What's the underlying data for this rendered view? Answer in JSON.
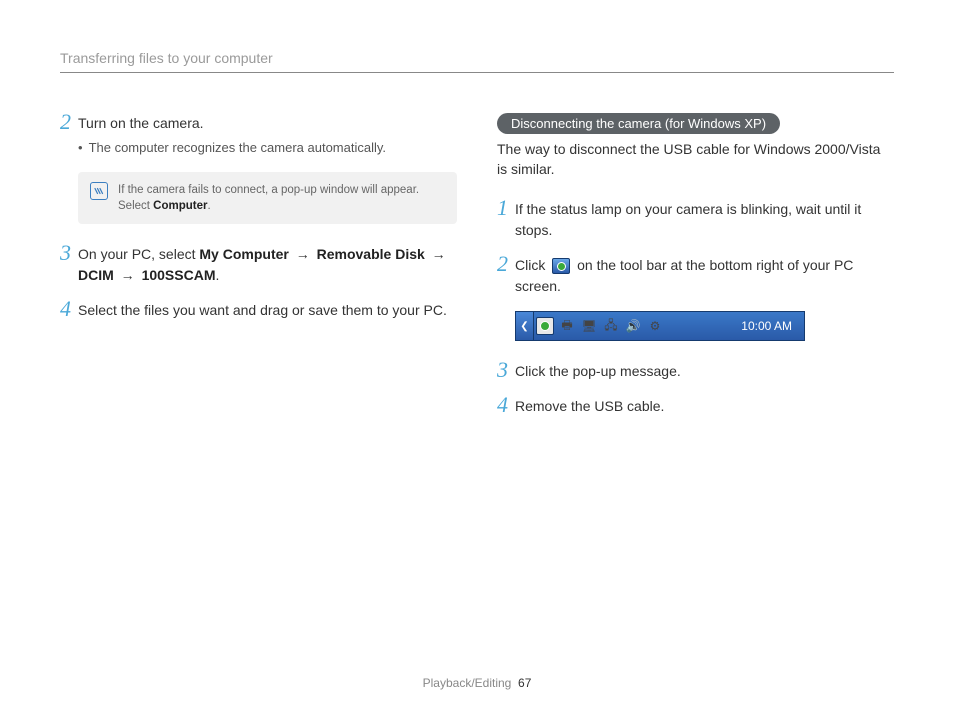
{
  "header": {
    "title": "Transferring files to your computer"
  },
  "left": {
    "step2": {
      "num": "2",
      "text": "Turn on the camera.",
      "bullet": "The computer recognizes the camera automatically."
    },
    "note": {
      "pre": "If the camera fails to connect, a pop-up window will appear. Select ",
      "bold": "Computer",
      "post": "."
    },
    "step3": {
      "num": "3",
      "pre": "On your PC, select ",
      "b1": "My Computer",
      "arr": " → ",
      "b2": "Removable Disk",
      "b3": "DCIM",
      "b4": "100SSCAM",
      "post": "."
    },
    "step4": {
      "num": "4",
      "text": "Select the files you want and drag or save them to your PC."
    }
  },
  "right": {
    "pill": "Disconnecting the camera (for Windows XP)",
    "intro": "The way to disconnect the USB cable for Windows 2000/Vista is similar.",
    "step1": {
      "num": "1",
      "text": "If the status lamp on your camera is blinking, wait until it stops."
    },
    "step2": {
      "num": "2",
      "pre": "Click ",
      "post": " on the tool bar at the bottom right of your PC screen."
    },
    "taskbar": {
      "time": "10:00 AM"
    },
    "step3": {
      "num": "3",
      "text": "Click the pop-up message."
    },
    "step4": {
      "num": "4",
      "text": "Remove the USB cable."
    }
  },
  "footer": {
    "section": "Playback/Editing",
    "page": "67"
  }
}
